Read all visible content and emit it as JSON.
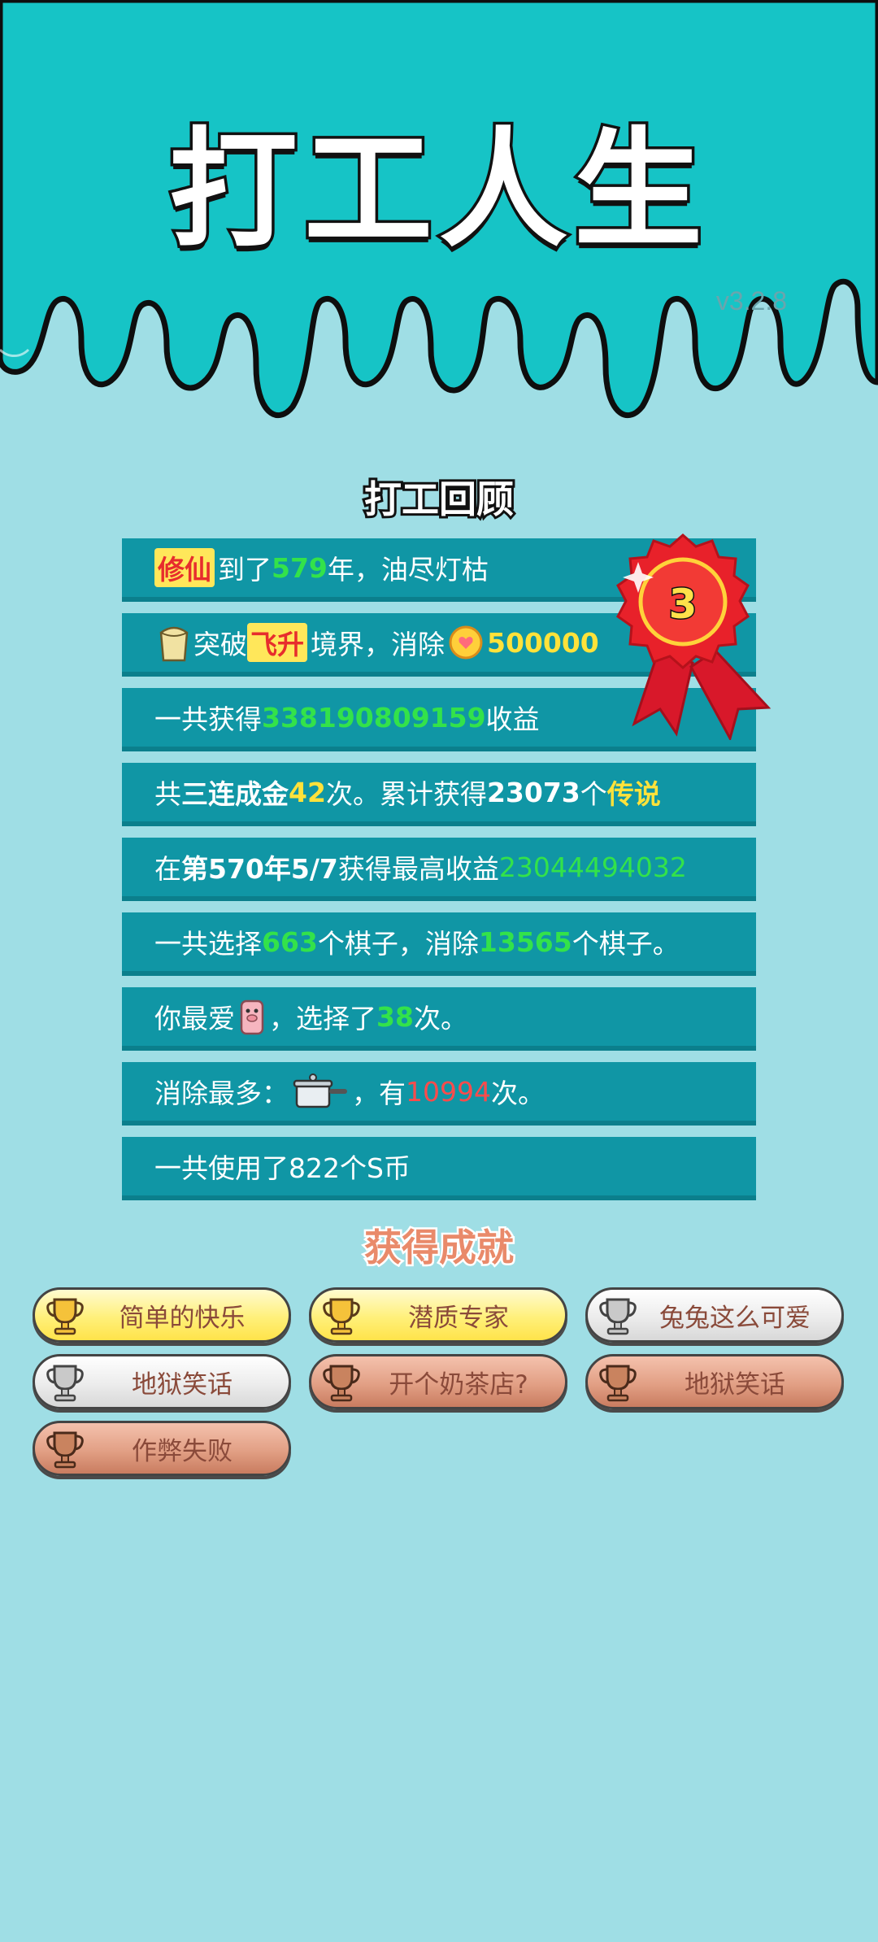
{
  "header": {
    "title": "打工人生",
    "version": "v3.2.8"
  },
  "review": {
    "title": "打工回顾",
    "rank_badge": "3",
    "rows": [
      {
        "parts": [
          "修仙",
          "到了",
          "579",
          "年，油尽灯枯"
        ]
      },
      {
        "parts": [
          "突破",
          "飞升",
          "境界，消除",
          "500000"
        ]
      },
      {
        "parts": [
          "一共获得",
          "338190809159",
          "收益"
        ]
      },
      {
        "parts": [
          "共",
          "三连成金",
          "42",
          "次。累计获得",
          "23073",
          "个",
          "传说"
        ]
      },
      {
        "parts": [
          "在 ",
          "第570年5/7",
          " 获得最高收益",
          "23044494032"
        ]
      },
      {
        "parts": [
          "一共选择",
          "663",
          "个棋子，消除",
          "13565",
          "个棋子。"
        ]
      },
      {
        "parts": [
          "你最爱",
          "，选择了",
          "38",
          "次。"
        ]
      },
      {
        "parts": [
          "消除最多：",
          "，有",
          "10994",
          "次。"
        ]
      },
      {
        "parts": [
          "一共使用了822个S币"
        ]
      }
    ]
  },
  "achievements": {
    "title": "获得成就",
    "items": [
      {
        "label": "简单的快乐",
        "tier": "gold"
      },
      {
        "label": "潜质专家",
        "tier": "gold"
      },
      {
        "label": "兔兔这么可爱",
        "tier": "silver"
      },
      {
        "label": "地狱笑话",
        "tier": "silver"
      },
      {
        "label": "开个奶茶店?",
        "tier": "bronze"
      },
      {
        "label": "地狱笑话",
        "tier": "bronze"
      },
      {
        "label": "作弊失败",
        "tier": "bronze"
      }
    ]
  },
  "colors": {
    "background": "#9fdee5",
    "header": "#16c4c6",
    "row": "#1096a5",
    "highlight_green": "#33e24a",
    "highlight_yellow": "#ffe23a",
    "highlight_red": "#ff4b4b",
    "badge_red": "#e01e1e"
  },
  "icons": [
    "bucket-icon",
    "coin-icon",
    "pig-icon",
    "pot-icon",
    "trophy-icon",
    "rosette-badge-icon"
  ]
}
